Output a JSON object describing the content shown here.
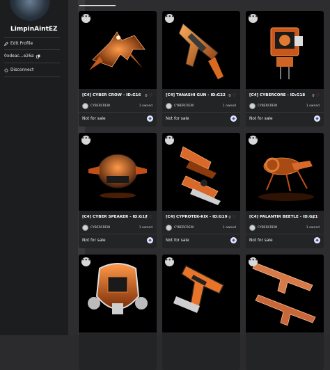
{
  "profile": {
    "username": "LimpinAintEZ",
    "menu": [
      {
        "label": "Edit Profile",
        "icon": "pencil-icon"
      },
      {
        "label": "0xdeac...e26a",
        "icon": "copy-icon"
      },
      {
        "label": "Disconnect",
        "icon": "power-icon"
      }
    ]
  },
  "cards": [
    {
      "title": "[C4] CYBER CROW - ID:G16",
      "likes": "0",
      "creator": "CYBERCREW",
      "owned": "1 owned",
      "status": "Not for sale"
    },
    {
      "title": "[C4] TANASHI GUN - ID:G22",
      "likes": "0",
      "creator": "CYBERCREW",
      "owned": "1 owned",
      "status": "Not for sale"
    },
    {
      "title": "[C4] CYBERCORE - ID:G18",
      "likes": "0",
      "creator": "CYBERCREW",
      "owned": "1 owned",
      "status": "Not for sale"
    },
    {
      "title": "[C4] CYBER SPEAKER - ID:G17",
      "likes": "0",
      "creator": "CYBERCREW",
      "owned": "1 owned",
      "status": "Not for sale"
    },
    {
      "title": "[C4] CYPROTEK-KIX - ID:G19",
      "likes": "0",
      "creator": "CYBERCREW",
      "owned": "1 owned",
      "status": "Not for sale"
    },
    {
      "title": "[C4] PALANTIR BEETLE - ID:G21",
      "likes": "0",
      "creator": "CYBERCREW",
      "owned": "1 owned",
      "status": "Not for sale"
    },
    {
      "title": "",
      "likes": "",
      "creator": "",
      "owned": "",
      "status": ""
    },
    {
      "title": "",
      "likes": "",
      "creator": "",
      "owned": "",
      "status": ""
    },
    {
      "title": "",
      "likes": "",
      "creator": "",
      "owned": "",
      "status": ""
    }
  ],
  "colors": {
    "accent": "#e8742a",
    "sidebar": "#1c1d1f",
    "card": "#232426",
    "heart": "#e04848"
  }
}
